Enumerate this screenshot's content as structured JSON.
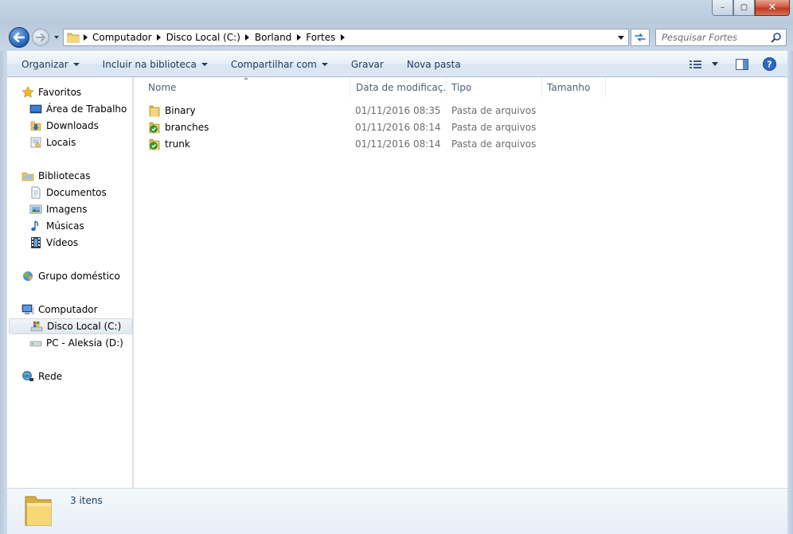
{
  "window": {
    "controls": {
      "minimize": "–",
      "maximize": "▢",
      "close": "✕"
    }
  },
  "address": {
    "crumbs": [
      "Computador",
      "Disco Local (C:)",
      "Borland",
      "Fortes"
    ]
  },
  "search": {
    "placeholder": "Pesquisar Fortes"
  },
  "toolbar": {
    "organize": "Organizar",
    "include_library": "Incluir na biblioteca",
    "share_with": "Compartilhar com",
    "burn": "Gravar",
    "new_folder": "Nova pasta"
  },
  "sidebar": {
    "favorites": {
      "label": "Favoritos",
      "items": [
        {
          "label": "Área de Trabalho",
          "icon": "desktop-icon"
        },
        {
          "label": "Downloads",
          "icon": "downloads-icon"
        },
        {
          "label": "Locais",
          "icon": "recent-places-icon"
        }
      ]
    },
    "libraries": {
      "label": "Bibliotecas",
      "items": [
        {
          "label": "Documentos",
          "icon": "documents-icon"
        },
        {
          "label": "Imagens",
          "icon": "pictures-icon"
        },
        {
          "label": "Músicas",
          "icon": "music-icon"
        },
        {
          "label": "Vídeos",
          "icon": "videos-icon"
        }
      ]
    },
    "homegroup": {
      "label": "Grupo doméstico"
    },
    "computer": {
      "label": "Computador",
      "items": [
        {
          "label": "Disco Local (C:)",
          "icon": "local-disk-icon",
          "selected": true
        },
        {
          "label": "PC - Aleksia (D:)",
          "icon": "drive-icon"
        }
      ]
    },
    "network": {
      "label": "Rede"
    }
  },
  "columns": {
    "name": "Nome",
    "date": "Data de modificaç...",
    "type": "Tipo",
    "size": "Tamanho"
  },
  "files": [
    {
      "name": "Binary",
      "date": "01/11/2016 08:35",
      "type": "Pasta de arquivos",
      "icon": "folder-icon"
    },
    {
      "name": "branches",
      "date": "01/11/2016 08:14",
      "type": "Pasta de arquivos",
      "icon": "svn-folder-icon"
    },
    {
      "name": "trunk",
      "date": "01/11/2016 08:14",
      "type": "Pasta de arquivos",
      "icon": "svn-folder-icon"
    }
  ],
  "status": {
    "item_count": "3 itens"
  },
  "colors": {
    "accent": "#1e395b",
    "selection": "#e1e8ef",
    "svn_badge": "#2e9a2e"
  }
}
